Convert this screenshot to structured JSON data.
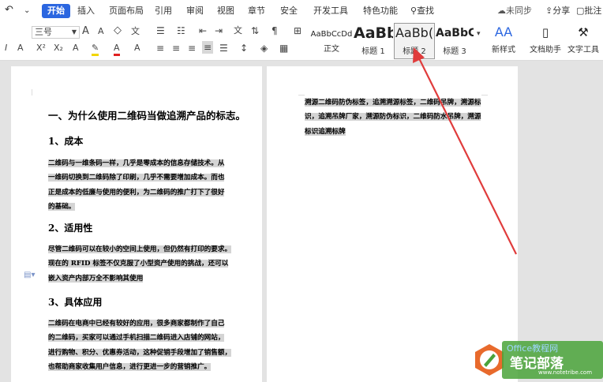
{
  "menu": {
    "tabs": [
      "开始",
      "插入",
      "页面布局",
      "引用",
      "审阅",
      "视图",
      "章节",
      "安全",
      "开发工具",
      "特色功能"
    ],
    "search_label": "查找",
    "sync_label": "未同步",
    "share_label": "分享",
    "comment_label": "批注"
  },
  "toolbar": {
    "font_size": "三号",
    "styles": [
      {
        "preview": "AaBbCcDd",
        "label": "正文"
      },
      {
        "preview": "AaBb",
        "label": "标题 1"
      },
      {
        "preview": "AaBb(",
        "label": "标题 2"
      },
      {
        "preview": "AaBbC",
        "label": "标题 3"
      }
    ],
    "new_style_label": "新样式",
    "doc_assistant_label": "文档助手",
    "text_tool_label": "文字工具"
  },
  "document": {
    "page1": {
      "title": "一、为什么使用二维码当做追溯产品的标志。",
      "sections": [
        {
          "heading": "1、成本",
          "lines": [
            "二维码与一维条码一样，几乎是零成本的信息存储技术。从",
            "一维码切换到二维码除了印刷，几乎不需要增加成本。而也",
            "正是成本的低廉与使用的便利，为二维码的推广打下了很好",
            "的基础。"
          ]
        },
        {
          "heading": "2、适用性",
          "lines": [
            "尽管二维码可以在较小的空间上使用，但仍然有打印的要求。",
            "现在的 RFID 标签不仅克服了小型资产使用的挑战，还可以",
            "嵌入资产内部万全不影响其使用"
          ]
        },
        {
          "heading": "3、具体应用",
          "lines": [
            "二维码在电商中已经有较好的应用，很多商家都制作了自己",
            "的二维码，买家可以通过手机扫描二维码进入店铺的网站，",
            "进行购物、积分、优惠券活动，这种促销手段增加了销售额，",
            "也帮助商家收集用户信息，进行更进一步的营销推广。"
          ]
        }
      ]
    },
    "page2": {
      "lines": [
        "溯源二维码防伪标签，追溯溯源标签，二维码吊牌，溯源标",
        "识，追溯吊牌厂家，溯源防伪标识，二维码防水吊牌，溯源",
        "标识追溯标牌"
      ]
    }
  },
  "watermark": {
    "brand_top": "Office教程网",
    "brand_main": "笔记部落",
    "url": "www.notetribe.com"
  },
  "colors": {
    "accent": "#2b66e0",
    "arrow": "#e03c3c",
    "highlight": "#d4d4d4"
  }
}
